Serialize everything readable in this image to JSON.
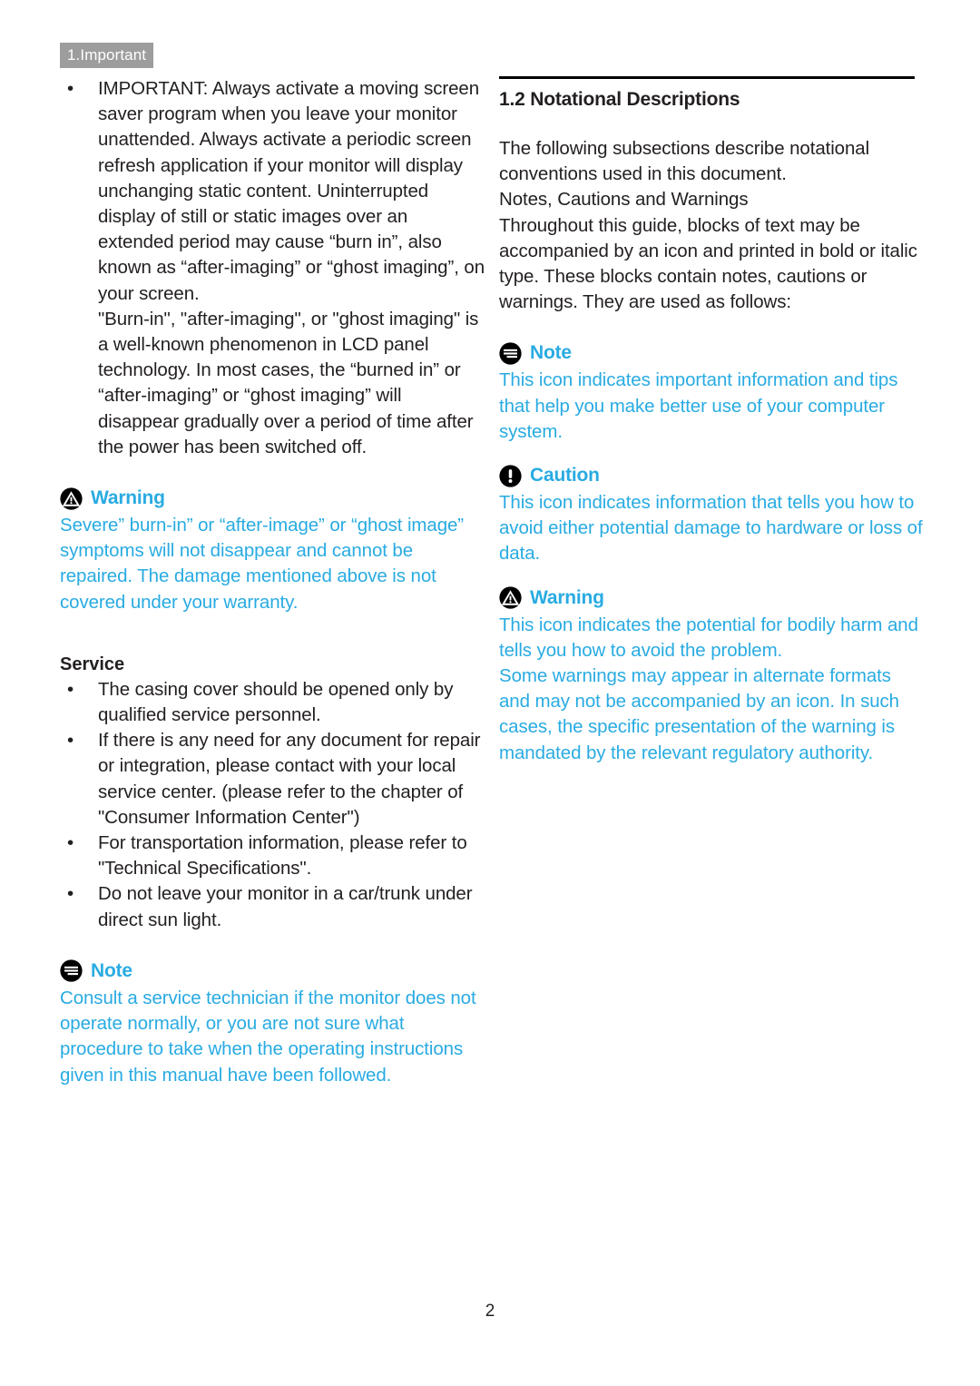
{
  "chapter_tab": "1.Important",
  "page_number": "2",
  "colors": {
    "accent_blue": "#29abe2",
    "tab_gray": "#9d9d9d",
    "body_text": "#231f20"
  },
  "left_column": {
    "important_bullet": "IMPORTANT: Always activate a moving screen saver program when you leave your monitor unattended. Always activate a periodic screen refresh application if your monitor will display unchanging static content. Uninterrupted display of still or static images over an extended period may cause “burn in”, also known as “after-imaging” or “ghost imaging”,  on your screen.",
    "burn_in_paragraph": "\"Burn-in\", \"after-imaging\", or \"ghost imaging\" is a well-known phenomenon in LCD panel technology. In most cases, the “burned in” or “after-imaging” or “ghost imaging” will disappear gradually over a period of time after the power has been switched off.",
    "warning": {
      "icon": "warning-triangle-icon",
      "title": "Warning",
      "body": "Severe” burn-in” or “after-image” or “ghost image” symptoms will not disappear and cannot be repaired. The damage mentioned above is not covered under your warranty."
    },
    "service_heading": "Service",
    "service_bullets": [
      "The casing cover should be opened only by qualified service personnel.",
      "If there is any need for any document for repair or integration, please contact with your local service center. (please refer to the chapter of \"Consumer Information Center\")",
      "For transportation information, please refer to \"Technical Specifications\".",
      "Do not leave your monitor in a car/trunk under direct sun light."
    ],
    "note": {
      "icon": "note-document-icon",
      "title": "Note",
      "body": "Consult a service technician if the monitor does not operate normally, or you are not sure what procedure to take when the operating instructions given in this manual have been followed."
    }
  },
  "right_column": {
    "section_title": "1.2 Notational Descriptions",
    "intro": "The following subsections describe notational conventions used in this document.",
    "subsection_heading": "Notes, Cautions and Warnings",
    "subsection_body": "Throughout this guide, blocks of text may be accompanied by an icon and printed in bold or italic type. These blocks contain notes, cautions or warnings. They are used as follows:",
    "note": {
      "icon": "note-document-icon",
      "title": "Note",
      "body": "This icon indicates important information and tips that help you make better use of your computer system."
    },
    "caution": {
      "icon": "caution-exclamation-icon",
      "title": "Caution",
      "body": "This icon indicates information that tells you how to avoid either potential damage to hardware or loss of data."
    },
    "warning": {
      "icon": "warning-triangle-icon",
      "title": "Warning",
      "body_1": "This icon indicates the potential for bodily harm and tells you how to avoid the problem.",
      "body_2": "Some warnings may appear in alternate formats and may not be accompanied by an icon. In such cases, the specific presentation of the warning is mandated by the relevant regulatory authority."
    }
  },
  "bullet_glyph": "•"
}
